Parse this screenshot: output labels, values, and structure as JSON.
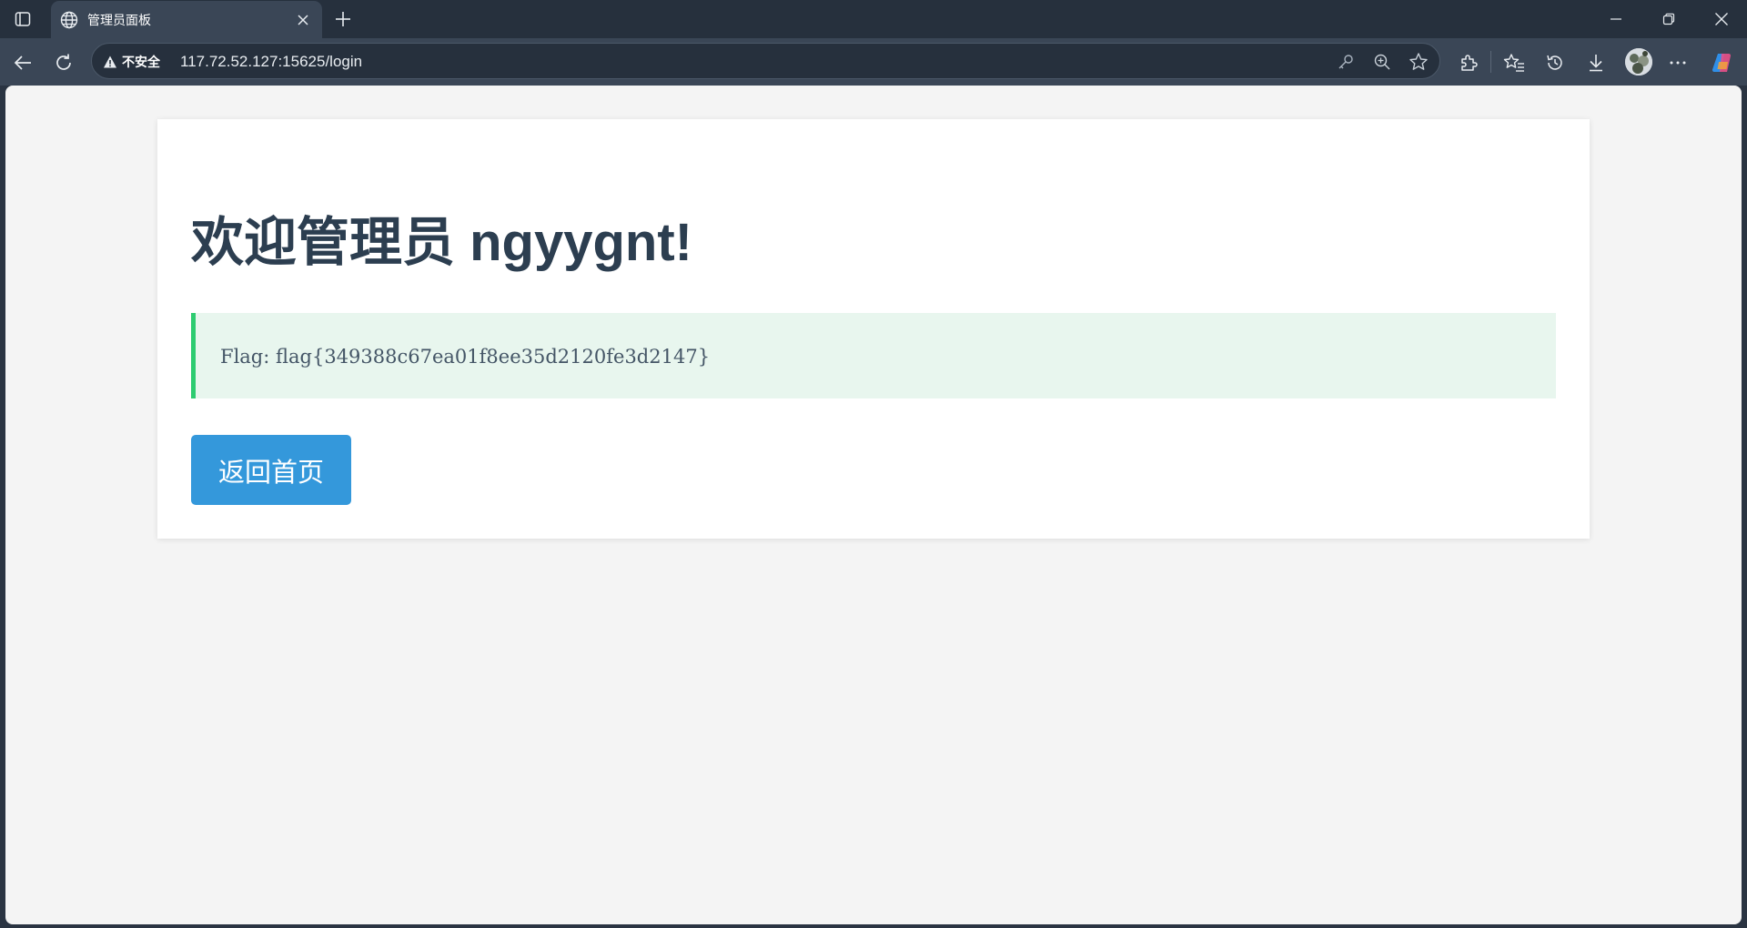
{
  "browser": {
    "tab": {
      "title": "管理员面板"
    },
    "address_bar": {
      "security_label": "不安全",
      "url": "117.72.52.127:15625/login"
    }
  },
  "page": {
    "heading": "欢迎管理员 ngyygnt!",
    "flag_text": "Flag: flag{349388c67ea01f8ee35d2120fe3d2147}",
    "home_button_label": "返回首页"
  },
  "colors": {
    "heading": "#2c3e50",
    "flag_box_bg": "#e8f6ee",
    "flag_box_border": "#2ecc71",
    "button_bg": "#3498db",
    "page_bg": "#f4f4f4"
  }
}
